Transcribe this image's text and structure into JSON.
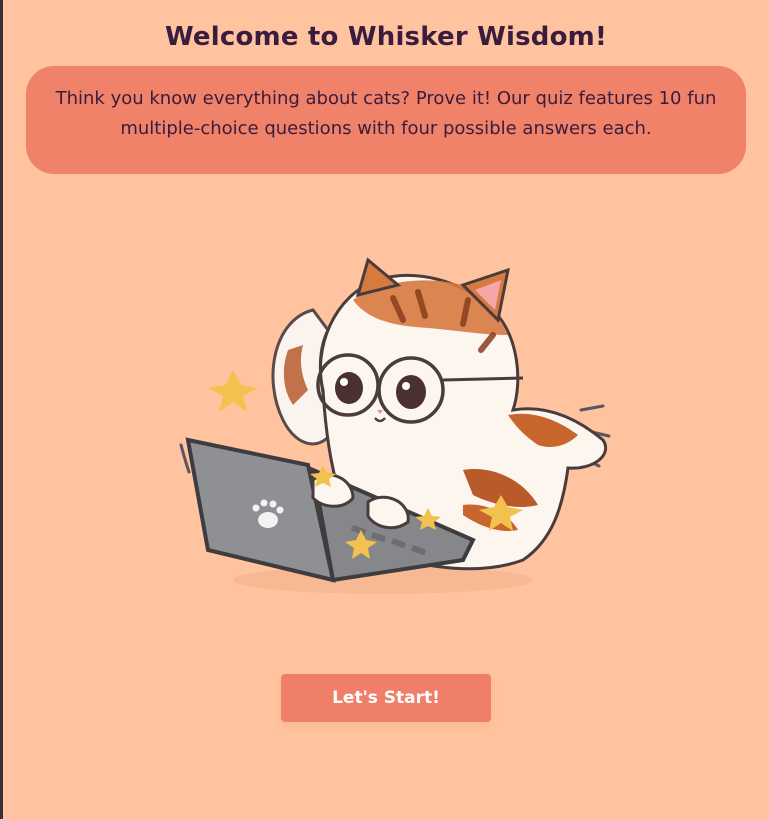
{
  "header": {
    "title": "Welcome to Whisker Wisdom!"
  },
  "intro": {
    "text": "Think you know everything about cats? Prove it! Our quiz features 10 fun multiple-choice questions with four possible answers each."
  },
  "illustration": {
    "subject": "cat-with-glasses-typing-on-laptop"
  },
  "actions": {
    "start_label": "Let's Start!"
  },
  "colors": {
    "background": "#ffc49f",
    "accent": "#ef8268",
    "title_text": "#3a1c3f",
    "button_text": "#ffffff"
  }
}
